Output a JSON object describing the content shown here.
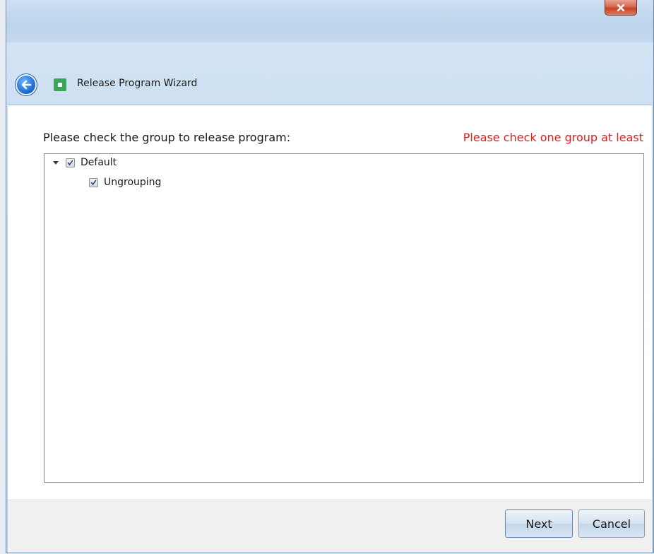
{
  "window": {
    "title": "Release Program Wizard",
    "close_label": "x"
  },
  "content": {
    "instruction": "Please check the group to release program:",
    "validation_message": "Please check one group at least",
    "validation_color": "#e0201c"
  },
  "tree": {
    "items": [
      {
        "label": "Default",
        "checked": true,
        "expanded": true
      },
      {
        "label": "Ungrouping",
        "checked": true
      }
    ]
  },
  "footer": {
    "next_label": "Next",
    "cancel_label": "Cancel"
  },
  "icons": {
    "back": "back-arrow-icon",
    "app": "app-icon",
    "close": "close-icon",
    "expander": "expand-triangle-icon",
    "check": "checkmark-icon"
  }
}
